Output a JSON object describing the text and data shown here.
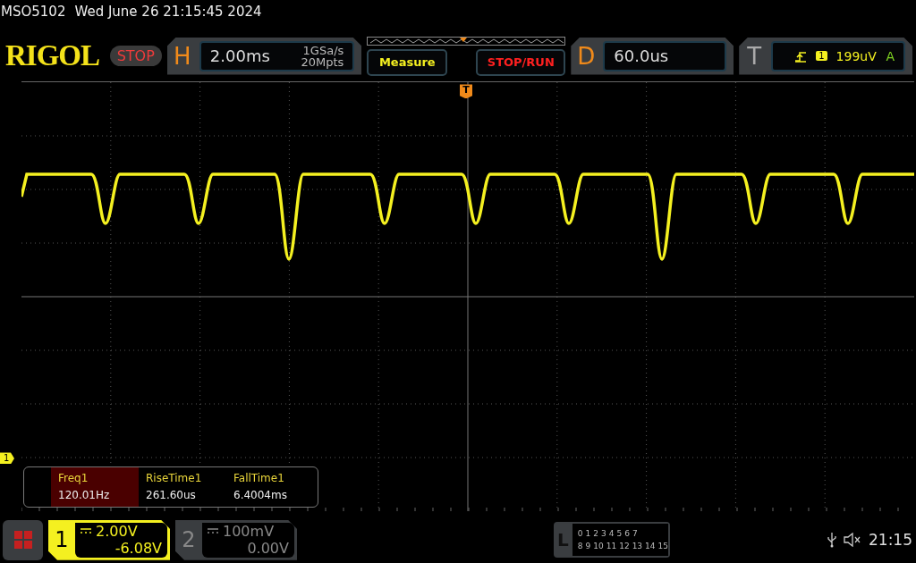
{
  "status_line": {
    "model": "MSO5102",
    "datetime": "Wed June 26 21:15:45 2024"
  },
  "logo": "RIGOL",
  "run_state": {
    "label": "STOP",
    "kind": "stop"
  },
  "horizontal": {
    "key": "H",
    "timebase": "2.00ms",
    "sample_rate": "1GSa/s",
    "memory_depth": "20Mpts"
  },
  "buttons": [
    {
      "label": "Measure",
      "kind": "measure"
    },
    {
      "label": "STOP/RUN",
      "kind": "stoprun"
    }
  ],
  "delay": {
    "key": "D",
    "value": "60.0us"
  },
  "trigger": {
    "key": "T",
    "source": "1",
    "level": "199uV",
    "mode": "A"
  },
  "screen": {
    "trigger_marker": "T",
    "channel_marker": "1"
  },
  "measurements": [
    {
      "name": "Freq1",
      "value": "120.01Hz",
      "selected": true
    },
    {
      "name": "RiseTime1",
      "value": "261.60us",
      "selected": false
    },
    {
      "name": "FallTime1",
      "value": "6.4004ms",
      "selected": false
    }
  ],
  "channels": [
    {
      "number": "1",
      "scale": "2.00V",
      "offset": "-6.08V",
      "on": true
    },
    {
      "number": "2",
      "scale": "100mV",
      "offset": "0.00V",
      "on": false
    }
  ],
  "logic": {
    "key": "L",
    "row_1": [
      "0",
      "1",
      "2",
      "3",
      "4",
      "5",
      "6",
      "7"
    ],
    "row_2": [
      "8",
      "9",
      "10",
      "11",
      "12",
      "13",
      "14",
      "15"
    ]
  },
  "status": {
    "time": "21:15"
  }
}
